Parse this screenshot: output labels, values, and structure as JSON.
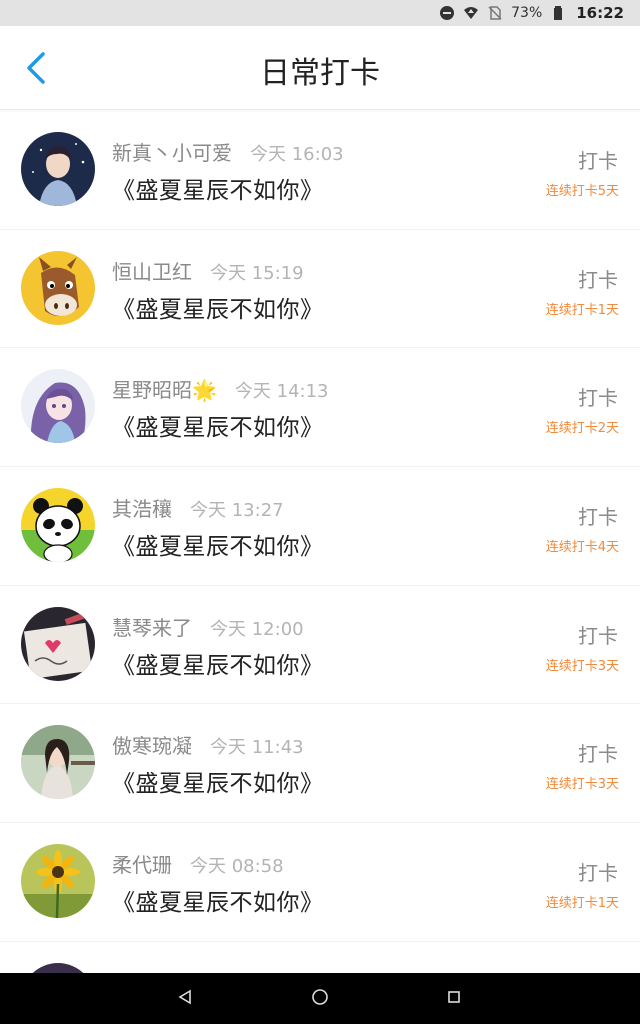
{
  "status_bar": {
    "battery": "73%",
    "time": "16:22"
  },
  "header": {
    "title": "日常打卡",
    "accent": "#1e9be8"
  },
  "checkins": [
    {
      "user": "新真丶小可爱",
      "time": "今天 16:03",
      "book": "《盛夏星辰不如你》",
      "action": "打卡",
      "streak": "连续打卡5天",
      "avatar": "boy-portrait-icon"
    },
    {
      "user": "恒山卫红",
      "time": "今天 15:19",
      "book": "《盛夏星辰不如你》",
      "action": "打卡",
      "streak": "连续打卡1天",
      "avatar": "horse-cartoon-icon"
    },
    {
      "user": "星野昭昭🌟",
      "time": "今天 14:13",
      "book": "《盛夏星辰不如你》",
      "action": "打卡",
      "streak": "连续打卡2天",
      "avatar": "anime-girl-icon"
    },
    {
      "user": "其浩穰",
      "time": "今天 13:27",
      "book": "《盛夏星辰不如你》",
      "action": "打卡",
      "streak": "连续打卡4天",
      "avatar": "panda-cartoon-icon"
    },
    {
      "user": "慧琴来了",
      "time": "今天 12:00",
      "book": "《盛夏星辰不如你》",
      "action": "打卡",
      "streak": "连续打卡3天",
      "avatar": "love-note-icon"
    },
    {
      "user": "傲寒琬凝",
      "time": "今天 11:43",
      "book": "《盛夏星辰不如你》",
      "action": "打卡",
      "streak": "连续打卡3天",
      "avatar": "girl-photo-icon"
    },
    {
      "user": "柔代珊",
      "time": "今天 08:58",
      "book": "《盛夏星辰不如你》",
      "action": "打卡",
      "streak": "连续打卡1天",
      "avatar": "sunflower-icon"
    }
  ],
  "colors": {
    "streak": "#f08a3c",
    "username": "#8a8a8a",
    "timestamp": "#b4b4b4"
  }
}
